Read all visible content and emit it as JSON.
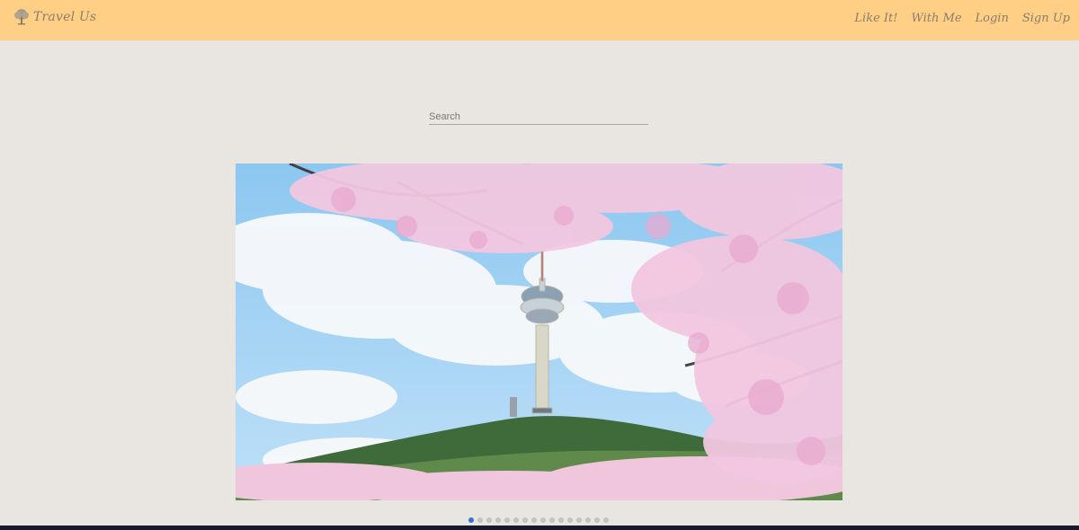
{
  "navbar": {
    "brand": "Travel Us",
    "brand_icon": "tree-icon",
    "links": [
      "Like It!",
      "With Me",
      "Login",
      "Sign Up"
    ]
  },
  "search": {
    "placeholder": "Search",
    "value": ""
  },
  "carousel": {
    "image_alt": "Cherry blossoms and a tall tower",
    "slide_count": 16,
    "active_index": 0
  },
  "colors": {
    "navbar_bg": "#ffcf86",
    "page_bg": "#e9e6e1",
    "active_dot": "#3b6fd4",
    "inactive_dot": "#c5c3c0",
    "footer_bar": "#15192b"
  }
}
